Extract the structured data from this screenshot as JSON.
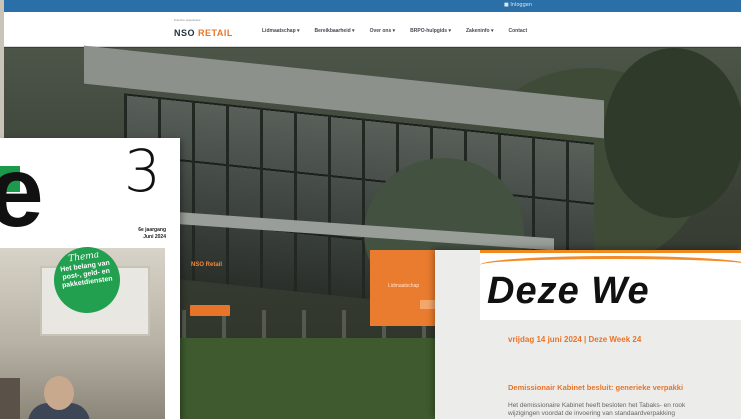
{
  "website": {
    "topbar_link": "■ Inloggen",
    "logo_tagline": "branche-organisatie",
    "logo_main": "NSO",
    "logo_accent": "RETAIL",
    "menu": [
      "Lidmaatschap ▾",
      "Bereikbaarheid ▾",
      "Over ons ▾",
      "BRPO-hulpgids ▾",
      "Zakeninfo ▾",
      "Contact"
    ],
    "hero_card_title": "NSO Retail",
    "hero_orange_text": "Lidmaatschap"
  },
  "magazine": {
    "big_letter": "e",
    "issue_number": "3",
    "jaargang": "6e jaargang",
    "date": "Juni 2024",
    "theme_label": "Thema",
    "theme_text": "Het belang van post-, geld- en pakketdiensten"
  },
  "newsletter": {
    "title": "Deze We",
    "date_line": "vrijdag 14 juni 2024 | Deze Week 24",
    "headline": "Demissionair Kabinet besluit: generieke verpakki",
    "body_line1": "Het demissionaire Kabinet heeft besloten het Tabaks- en rook",
    "body_line2": "wijzigingen voordat de invoering van standaardverpakking"
  },
  "colors": {
    "accent_orange": "#e8742a",
    "brand_blue": "#2b6fa8",
    "theme_green": "#22a04f"
  }
}
